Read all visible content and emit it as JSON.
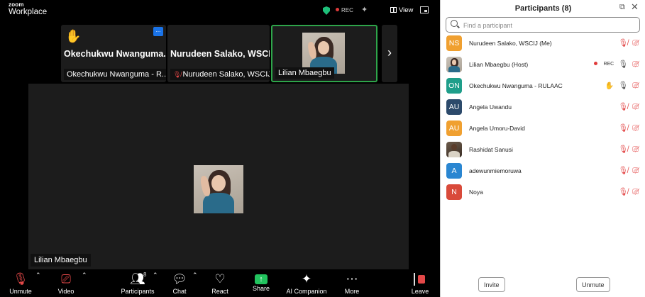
{
  "app": {
    "logo_line1": "zoom",
    "logo_line2": "Workplace"
  },
  "topbar": {
    "rec_label": "REC",
    "view_label": "View"
  },
  "thumbnails": [
    {
      "big_name": "Okechukwu Nwanguma...",
      "label": "Okechukwu Nwanguma - R...",
      "raised_hand": true,
      "more_label": "..."
    },
    {
      "big_name": "Nurudeen Salako, WSCIJ",
      "label": "Nurudeen Salako, WSCIJ",
      "mic_muted": true
    },
    {
      "label": "Lilian Mbaegbu",
      "video_on": true,
      "active_speaker": true
    }
  ],
  "main": {
    "speaker_name": "Lilian Mbaegbu"
  },
  "toolbar": {
    "unmute": "Unmute",
    "video": "Video",
    "participants": "Participants",
    "participants_count": "8",
    "chat": "Chat",
    "react": "React",
    "share": "Share",
    "ai_companion": "AI Companion",
    "more": "More",
    "leave": "Leave"
  },
  "panel": {
    "title": "Participants (8)",
    "search_placeholder": "Find a participant",
    "participants": [
      {
        "initials": "NS",
        "name": "Nurudeen Salako, WSCIJ (Me)",
        "avatar_color": "#f0a030",
        "mic": "muted",
        "video": "off"
      },
      {
        "initials": "",
        "name": "Lilian Mbaegbu (Host)",
        "avatar_type": "photo",
        "rec": "REC",
        "mic": "on",
        "video": "off"
      },
      {
        "initials": "ON",
        "name": "Okechukwu Nwanguma - RULAAC",
        "avatar_color": "#1f9e8a",
        "hand": true,
        "mic": "on",
        "video": "off"
      },
      {
        "initials": "AU",
        "name": "Angela Uwandu",
        "avatar_color": "#2c4a6b",
        "mic": "muted",
        "video": "off"
      },
      {
        "initials": "AU",
        "name": "Angela Umoru-David",
        "avatar_color": "#f0a030",
        "mic": "muted",
        "video": "off"
      },
      {
        "initials": "",
        "name": "Rashidat Sanusi",
        "avatar_type": "photo-dark",
        "mic": "muted",
        "video": "off"
      },
      {
        "initials": "A",
        "name": "adewunmiemoruwa",
        "avatar_color": "#2a86d1",
        "mic": "muted",
        "video": "off"
      },
      {
        "initials": "N",
        "name": "Noya",
        "avatar_color": "#d94a3a",
        "mic": "muted",
        "video": "off"
      }
    ],
    "invite_label": "Invite",
    "unmute_label": "Unmute"
  }
}
